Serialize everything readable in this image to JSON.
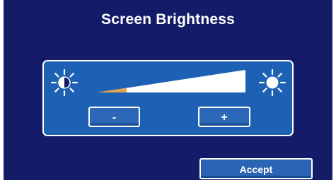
{
  "dialog": {
    "title": "Screen Brightness"
  },
  "brightness": {
    "level": 0.2,
    "min_icon": "sun-dim-icon",
    "max_icon": "sun-bright-icon",
    "fill_color": "#e3a34f",
    "track_color": "#ffffff"
  },
  "buttons": {
    "decrease_label": "-",
    "increase_label": "+",
    "accept_label": "Accept"
  },
  "colors": {
    "background": "#141b69",
    "panel": "#1c61b3",
    "button": "#2c67b8"
  }
}
